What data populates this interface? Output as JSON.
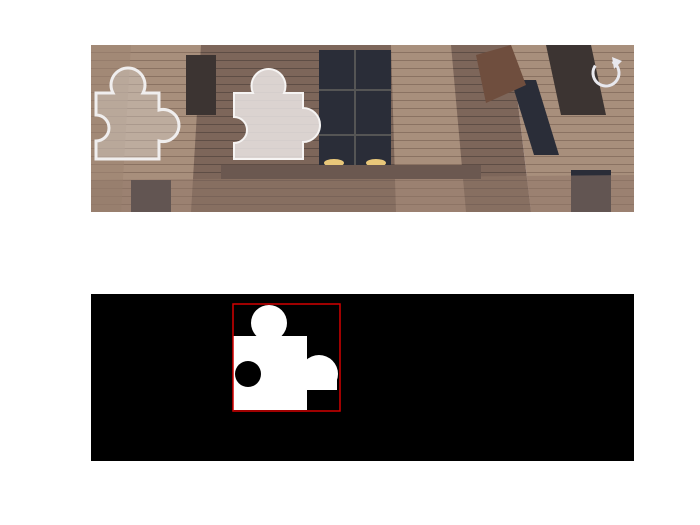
{
  "captcha": {
    "background_description_icon": "building-facade-photo",
    "refresh_icon": "refresh-icon",
    "colors": {
      "sky": "#cfc3dc",
      "facade_light": "#b39a86",
      "facade_mid": "#8f7668",
      "facade_dark": "#3c3432",
      "window": "#2a2d38",
      "lamp": "#e8c77a",
      "piece_fill": "#f2efee",
      "piece_outline": "#e6e2e0"
    }
  },
  "mask": {
    "bbox_color": "#d40000",
    "background": "#000000",
    "shape": "#ffffff"
  }
}
